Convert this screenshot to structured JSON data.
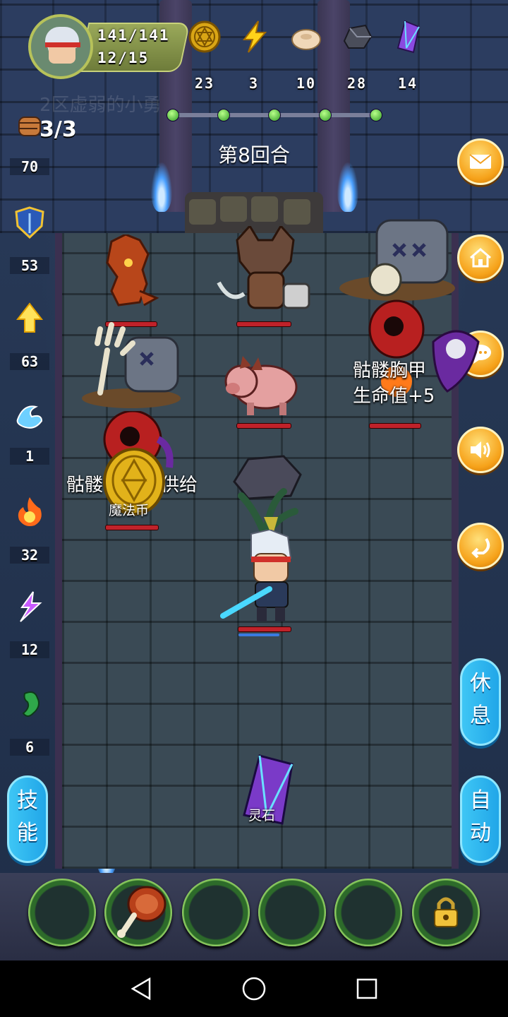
{
  "player": {
    "hp": "141/141",
    "stamina": "12/15"
  },
  "resources": [
    {
      "icon": "gold-coin-icon",
      "value": "23"
    },
    {
      "icon": "lightning-icon",
      "value": "3"
    },
    {
      "icon": "bun-icon",
      "value": "10"
    },
    {
      "icon": "ore-icon",
      "value": "28"
    },
    {
      "icon": "crystal-icon",
      "value": "14"
    }
  ],
  "ghost_text": "2区虚弱的小勇",
  "stage_progress": {
    "completed_nodes": 5,
    "total_nodes": 5
  },
  "round_label": "第8回合",
  "side_stats": [
    {
      "icon": "fist-icon",
      "value": "70"
    },
    {
      "icon": "shield-icon",
      "value": "53"
    },
    {
      "icon": "arrow-up-icon",
      "value": "63"
    },
    {
      "icon": "water-icon",
      "value": "1"
    },
    {
      "icon": "fire-icon",
      "value": "32"
    },
    {
      "icon": "lightning-purple-icon",
      "value": "12"
    },
    {
      "icon": "poison-icon",
      "value": "6"
    }
  ],
  "attack_count": "3/3",
  "floats": {
    "armor_gain_1": "骷髅胸甲",
    "armor_gain_2": "生命值+5",
    "supply_left": "骷髅",
    "supply_right": "供给",
    "coin_label": "魔法币",
    "stone_label": "灵石"
  },
  "buttons": {
    "rest": "休息",
    "skill": "技能",
    "auto": "自动"
  },
  "right_buttons": [
    "mail-icon",
    "home-icon",
    "chat-icon",
    "sound-icon",
    "back-icon"
  ],
  "slots": [
    "empty",
    "meat",
    "empty",
    "empty",
    "empty",
    "locked"
  ],
  "colors": {
    "accent": "#f6a21a",
    "pill": "#21a6e8",
    "hp": "#c0222a"
  }
}
